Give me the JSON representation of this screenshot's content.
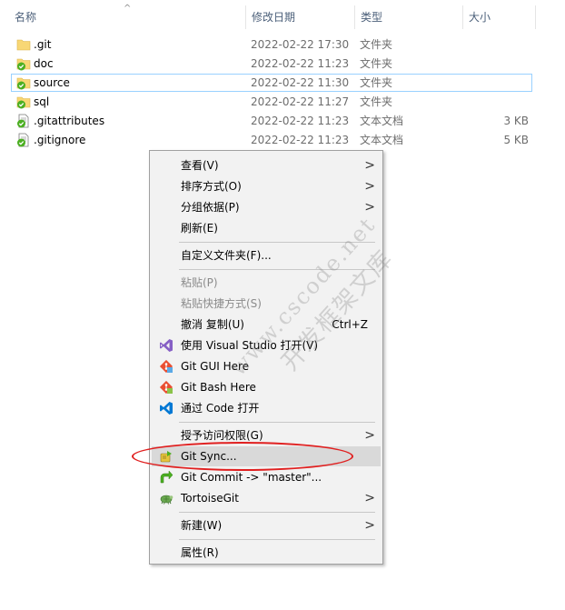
{
  "header": {
    "name": "名称",
    "modified": "修改日期",
    "type": "类型",
    "size": "大小",
    "sort_indicator": "^"
  },
  "files": [
    {
      "name": ".git",
      "modified": "2022-02-22 17:30",
      "type": "文件夹",
      "size": "",
      "icon": "folder-icon"
    },
    {
      "name": "doc",
      "modified": "2022-02-22 11:23",
      "type": "文件夹",
      "size": "",
      "icon": "git-folder-icon"
    },
    {
      "name": "source",
      "modified": "2022-02-22 11:30",
      "type": "文件夹",
      "size": "",
      "icon": "git-folder-icon"
    },
    {
      "name": "sql",
      "modified": "2022-02-22 11:27",
      "type": "文件夹",
      "size": "",
      "icon": "git-folder-icon"
    },
    {
      "name": ".gitattributes",
      "modified": "2022-02-22 11:23",
      "type": "文本文档",
      "size": "3 KB",
      "icon": "git-file-icon"
    },
    {
      "name": ".gitignore",
      "modified": "2022-02-22 11:23",
      "type": "文本文档",
      "size": "5 KB",
      "icon": "git-file-icon"
    }
  ],
  "selected_file": "source",
  "menu": {
    "view": "查看(V)",
    "sort_by": "排序方式(O)",
    "group_by": "分组依据(P)",
    "refresh": "刷新(E)",
    "customize": "自定义文件夹(F)...",
    "paste": "粘贴(P)",
    "paste_shortcut": "粘贴快捷方式(S)",
    "undo": "撤消 复制(U)",
    "undo_shortcut": "Ctrl+Z",
    "open_vs": "使用 Visual Studio 打开(V)",
    "git_gui": "Git GUI Here",
    "git_bash": "Git Bash Here",
    "open_code": "通过 Code 打开",
    "grant_access": "授予访问权限(G)",
    "git_sync": "Git Sync...",
    "git_commit": "Git Commit -> \"master\"...",
    "tortoisegit": "TortoiseGit",
    "new": "新建(W)",
    "properties": "属性(R)",
    "submenu_arrow": ">"
  },
  "watermark": {
    "line1": "www.cscode.net",
    "line2": "开发框架文库"
  },
  "colors": {
    "selection_border": "#99d1ff",
    "menu_bg": "#f2f2f2",
    "highlight_ring": "#e02020",
    "folder": "#f8d775",
    "git_check": "#4caf22",
    "vs_purple": "#865fc5",
    "vscode_blue": "#0078d4"
  }
}
